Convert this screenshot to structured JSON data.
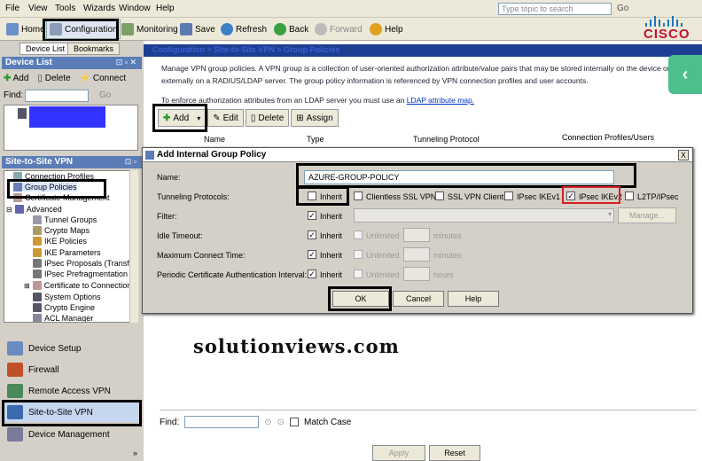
{
  "menu": {
    "items": [
      "File",
      "View",
      "Tools",
      "Wizards",
      "Window",
      "Help"
    ],
    "search_placeholder": "Type topic to search",
    "go": "Go"
  },
  "toolbar": {
    "home": "Home",
    "configuration": "Configuration",
    "monitoring": "Monitoring",
    "save": "Save",
    "refresh": "Refresh",
    "back": "Back",
    "forward": "Forward",
    "help": "Help"
  },
  "brand": {
    "name": "CISCO",
    "color": "#c8102e"
  },
  "left": {
    "tabs": [
      "Device List",
      "Bookmarks"
    ],
    "device_list": {
      "title": "Device List",
      "add": "Add",
      "delete": "Delete",
      "connect": "Connect",
      "find_label": "Find:",
      "go": "Go"
    },
    "site_to_site": {
      "title": "Site-to-Site VPN",
      "tree": [
        "Connection Profiles",
        "Group Policies",
        "Certificate Management",
        "Advanced",
        "Tunnel Groups",
        "Crypto Maps",
        "IKE Policies",
        "IKE Parameters",
        "IPsec Proposals (Transfo",
        "IPsec Prefragmentation P",
        "Certificate to Connection",
        "System Options",
        "Crypto Engine",
        "ACL Manager"
      ]
    },
    "nav": [
      "Device Setup",
      "Firewall",
      "Remote Access VPN",
      "Site-to-Site VPN",
      "Device Management"
    ]
  },
  "main": {
    "breadcrumb": "Configuration > Site-to-Site VPN > Group Policies",
    "desc1": "Manage VPN group policies. A VPN group is a collection of user-oriented authorization attribute/value pairs that may be stored internally on the device or",
    "desc2": "externally on a RADIUS/LDAP server. The group policy information is referenced by VPN connection profiles and user accounts.",
    "desc3": "To enforce authorization attributes from an LDAP server you must use an",
    "desc3_link": "LDAP attribute map.",
    "actions": {
      "add": "Add",
      "edit": "Edit",
      "delete": "Delete",
      "assign": "Assign"
    },
    "columns": [
      "Name",
      "Type",
      "Tunneling Protocol",
      "Connection Profiles/Users"
    ],
    "find_label": "Find:",
    "match_case": "Match Case",
    "apply": "Apply",
    "reset": "Reset"
  },
  "dialog": {
    "title": "Add Internal Group Policy",
    "close": "X",
    "name_label": "Name:",
    "name_value": "AZURE-GROUP-POLICY",
    "tunneling_label": "Tunneling Protocols:",
    "inherit": "Inherit",
    "protocols": [
      {
        "label": "Clientless SSL VPN",
        "checked": false
      },
      {
        "label": "SSL VPN Client",
        "checked": false
      },
      {
        "label": "IPsec IKEv1",
        "checked": false
      },
      {
        "label": "IPsec IKEv2",
        "checked": true
      },
      {
        "label": "L2TP/IPsec",
        "checked": false
      }
    ],
    "filter_label": "Filter:",
    "manage": "Manage...",
    "idle_label": "Idle Timeout:",
    "maxconn_label": "Maximum Connect Time:",
    "periodic_label": "Periodic Certificate Authentication Interval:",
    "unlimited": "Unlimited",
    "minutes": "minutes",
    "hours": "hours",
    "ok": "OK",
    "cancel": "Cancel",
    "help": "Help"
  },
  "watermark": "solutionviews.com"
}
